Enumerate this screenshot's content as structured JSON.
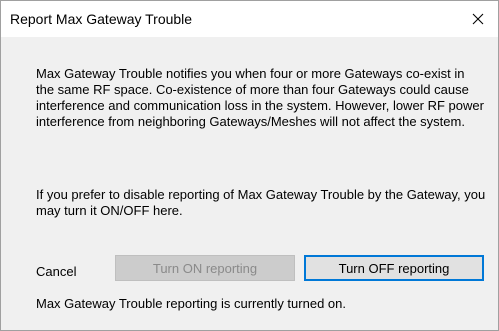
{
  "window": {
    "title": "Report Max Gateway Trouble"
  },
  "content": {
    "paragraph_1": "Max Gateway Trouble notifies you when four or more Gateways co-exist in the same RF space. Co-existence of more than four Gateways could cause interference and communication loss in the system. However, lower RF power interference from neighboring Gateways/Meshes will not affect the system.",
    "paragraph_2": "If you prefer to disable reporting of Max Gateway Trouble by the Gateway, you may turn it ON/OFF here."
  },
  "actions": {
    "cancel_label": "Cancel",
    "turn_on_label": "Turn ON reporting",
    "turn_off_label": "Turn OFF reporting"
  },
  "status": {
    "text": "Max Gateway Trouble reporting is currently turned on."
  },
  "icons": {
    "close": "close-icon"
  },
  "colors": {
    "focus_border": "#0078d7",
    "disabled_text": "#8a8a8a",
    "dialog_bg": "#f0f0f0"
  }
}
